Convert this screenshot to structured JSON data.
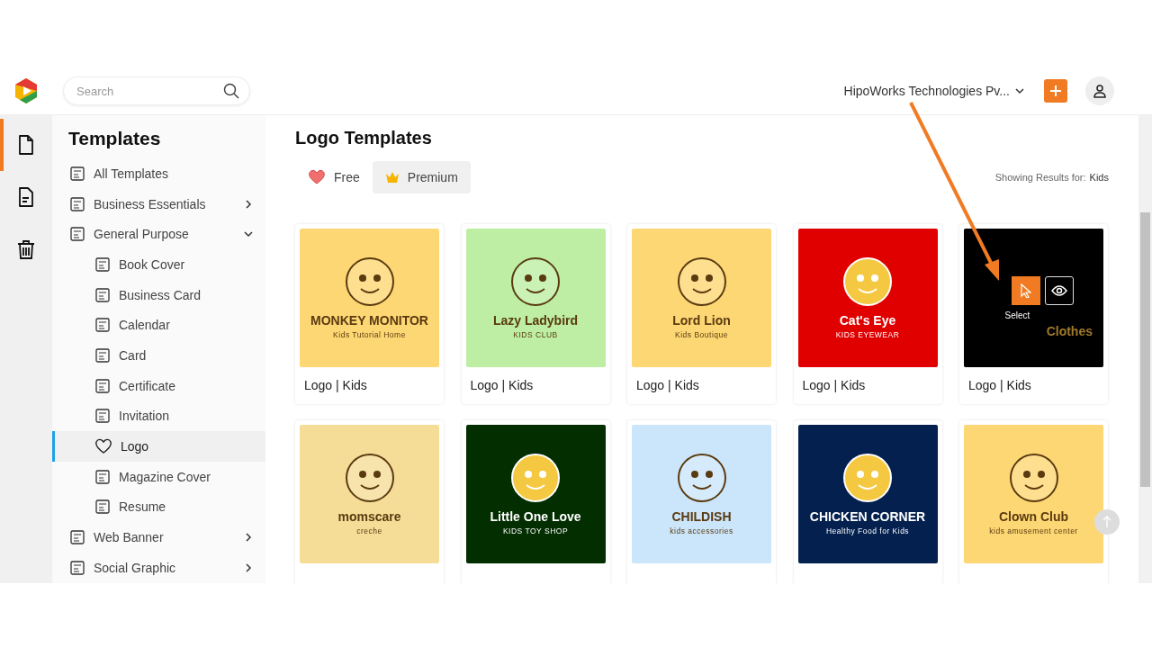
{
  "header": {
    "search": {
      "placeholder": "Search"
    },
    "account": "HipoWorks Technologies Pv..."
  },
  "rail": [
    {
      "selected": true
    },
    {
      "selected": false
    },
    {
      "selected": false
    }
  ],
  "sidebar": {
    "title": "Templates",
    "items": [
      {
        "label": "All Templates",
        "selected": false
      },
      {
        "label": "Business Essentials",
        "selected": false,
        "expanded": false
      },
      {
        "label": "General Purpose",
        "selected": false,
        "expanded": true,
        "children": [
          {
            "label": "Book Cover",
            "selected": false
          },
          {
            "label": "Business Card",
            "selected": false
          },
          {
            "label": "Calendar",
            "selected": false
          },
          {
            "label": "Card",
            "selected": false
          },
          {
            "label": "Certificate",
            "selected": false
          },
          {
            "label": "Invitation",
            "selected": false
          },
          {
            "label": "Logo",
            "selected": true
          },
          {
            "label": "Magazine Cover",
            "selected": false
          },
          {
            "label": "Resume",
            "selected": false
          }
        ]
      },
      {
        "label": "Web Banner",
        "selected": false,
        "expanded": false
      },
      {
        "label": "Social Graphic",
        "selected": false,
        "expanded": false
      }
    ]
  },
  "main": {
    "title": "Logo Templates",
    "filters": [
      {
        "label": "Free",
        "selected": false
      },
      {
        "label": "Premium",
        "selected": true
      }
    ],
    "results": {
      "label": "Showing Results for:",
      "value": "Kids"
    },
    "templates": [
      {
        "caption": "Logo | Kids",
        "color": "#fdd774",
        "logo_title": "MONKEY MONITOR",
        "tagline": "Kids Tutorial Home",
        "hovered": false
      },
      {
        "caption": "Logo | Kids",
        "color": "#bdeea4",
        "logo_title": "Lazy Ladybird",
        "tagline": "KIDS CLUB",
        "hovered": false
      },
      {
        "caption": "Logo | Kids",
        "color": "#fdd774",
        "logo_title": "Lord Lion",
        "tagline": "Kids Boutique",
        "hovered": false
      },
      {
        "caption": "Logo | Kids",
        "color": "#e00000",
        "logo_title": "Cat's Eye",
        "tagline": "KIDS EYEWEAR",
        "hovered": false
      },
      {
        "caption": "Logo | Kids",
        "color": "#000000",
        "logo_title": "Clothes",
        "hovered": true,
        "select_label": "Select"
      },
      {
        "color": "#f5dd98",
        "logo_title": "momscare",
        "tagline": "creche",
        "hovered": false
      },
      {
        "color": "#032e00",
        "logo_title": "Little One Love",
        "tagline": "KIDS TOY SHOP",
        "hovered": false
      },
      {
        "color": "#cbe6fb",
        "logo_title": "CHILDISH",
        "tagline": "kids accessories",
        "hovered": false
      },
      {
        "color": "#03204f",
        "logo_title": "CHICKEN CORNER",
        "tagline": "Healthy Food for Kids",
        "hovered": false
      },
      {
        "color": "#fdd774",
        "logo_title": "Clown Club",
        "tagline": "kids amusement center",
        "hovered": false
      }
    ]
  }
}
